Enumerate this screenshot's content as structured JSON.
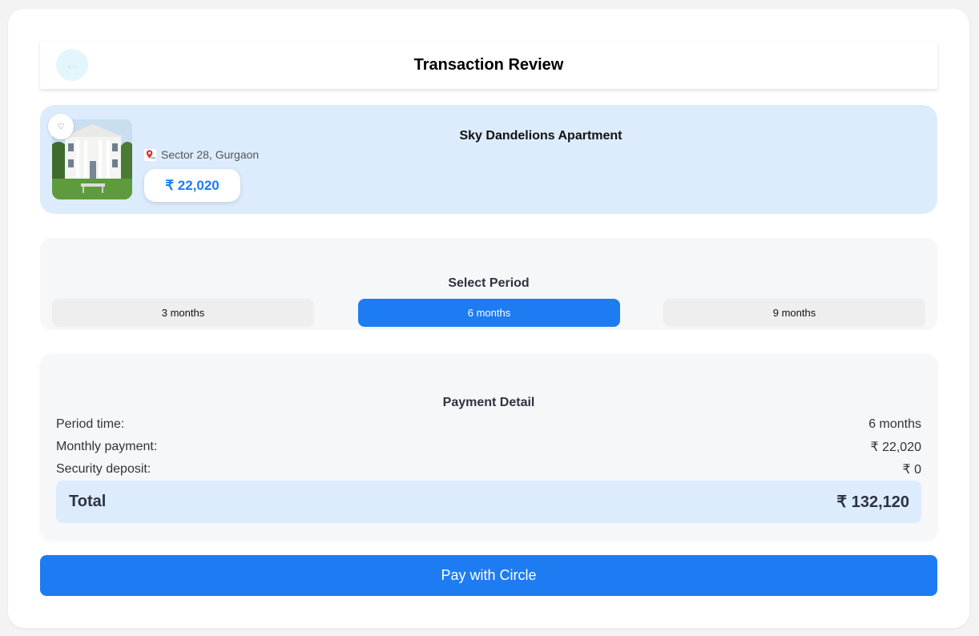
{
  "header": {
    "back_icon": "←",
    "title": "Transaction Review"
  },
  "property": {
    "favorite_icon": "♡",
    "name": "Sky Dandelions Apartment",
    "location": "Sector 28, Gurgaon",
    "price": "₹ 22,020"
  },
  "period": {
    "title": "Select Period",
    "options": [
      {
        "label": "3 months"
      },
      {
        "label": "6 months"
      },
      {
        "label": "9 months"
      }
    ],
    "selected": "6 months"
  },
  "payment": {
    "title": "Payment Detail",
    "rows": [
      {
        "label": "Period time:",
        "value": "6 months"
      },
      {
        "label": "Monthly payment:",
        "value": "₹ 22,020"
      },
      {
        "label": "Security deposit:",
        "value": "₹ 0"
      }
    ],
    "total_label": "Total",
    "total_value": "₹ 132,120"
  },
  "pay_button": {
    "label": "Pay with Circle"
  },
  "colors": {
    "primary": "#1e7cf2",
    "light_blue": "#dcecfd",
    "panel": "#f6f7f9",
    "pin_red": "#e0312b"
  }
}
